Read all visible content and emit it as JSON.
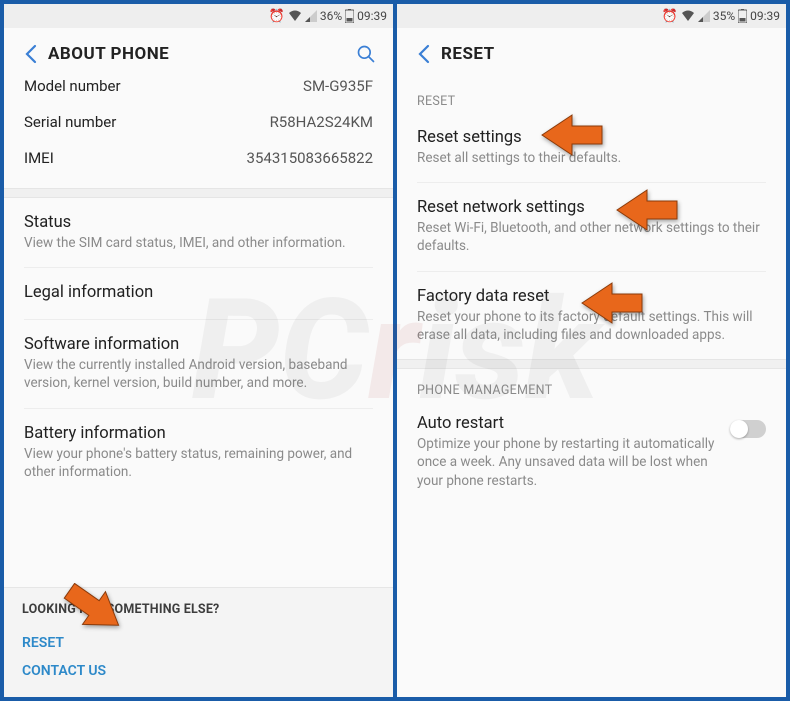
{
  "statusbar": {
    "battery": "36%",
    "battery2": "35%",
    "time": "09:39"
  },
  "left": {
    "title": "ABOUT PHONE",
    "rows": {
      "model": {
        "label": "Model number",
        "value": "SM-G935F"
      },
      "serial": {
        "label": "Serial number",
        "value": "R58HA2S24KM"
      },
      "imei": {
        "label": "IMEI",
        "value": "354315083665822"
      }
    },
    "status": {
      "title": "Status",
      "sub": "View the SIM card status, IMEI, and other information."
    },
    "legal": {
      "title": "Legal information"
    },
    "software": {
      "title": "Software information",
      "sub": "View the currently installed Android version, baseband version, kernel version, build number, and more."
    },
    "battery": {
      "title": "Battery information",
      "sub": "View your phone's battery status, remaining power, and other information."
    },
    "bottom": {
      "head": "LOOKING FOR SOMETHING ELSE?",
      "reset": "RESET",
      "contact": "CONTACT US"
    }
  },
  "right": {
    "title": "RESET",
    "section_reset": "RESET",
    "reset_settings": {
      "title": "Reset settings",
      "sub": "Reset all settings to their defaults."
    },
    "reset_network": {
      "title": "Reset network settings",
      "sub": "Reset Wi-Fi, Bluetooth, and other network settings to their defaults."
    },
    "factory": {
      "title": "Factory data reset",
      "sub": "Reset your phone to its factory default settings. This will erase all data, including files and downloaded apps."
    },
    "section_pm": "PHONE MANAGEMENT",
    "auto_restart": {
      "title": "Auto restart",
      "sub": "Optimize your phone by restarting it automatically once a week. Any unsaved data will be lost when your phone restarts."
    }
  },
  "watermark": {
    "text": "PCrisk.com"
  }
}
